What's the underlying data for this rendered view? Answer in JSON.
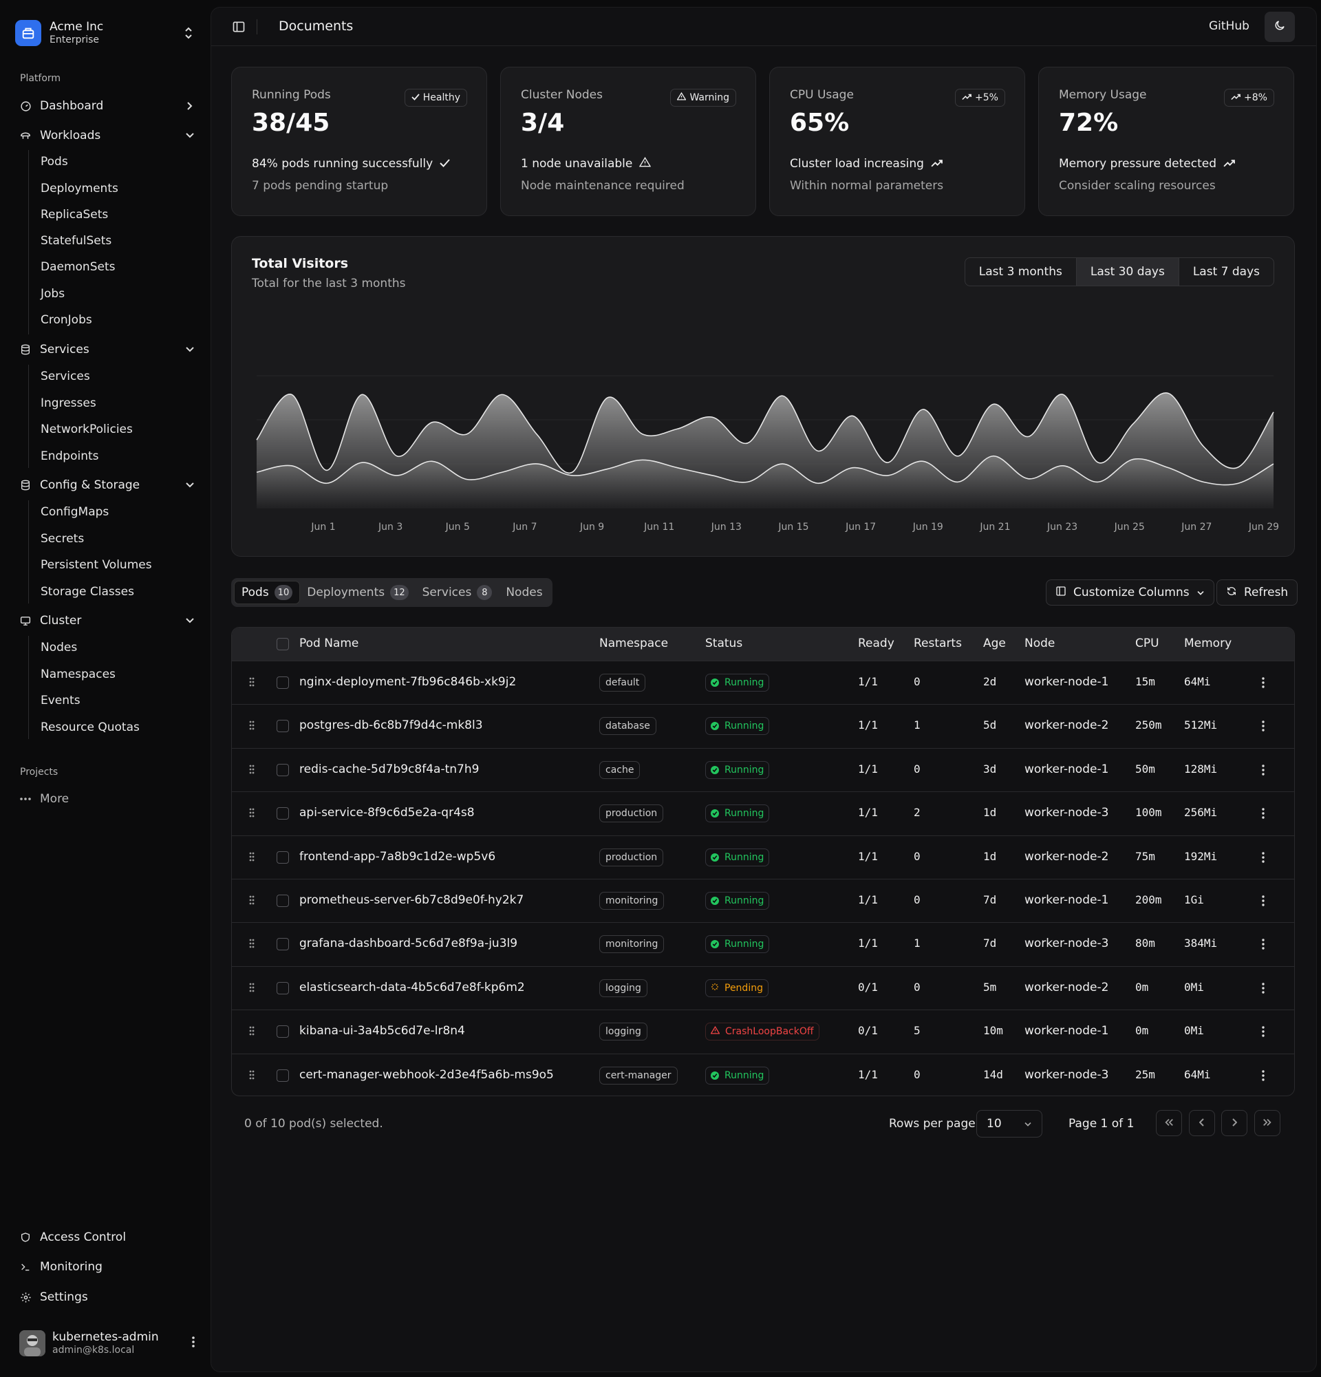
{
  "team": {
    "name": "Acme Inc",
    "plan": "Enterprise"
  },
  "sidebar": {
    "platform_label": "Platform",
    "dashboard": "Dashboard",
    "workloads": {
      "label": "Workloads",
      "items": [
        "Pods",
        "Deployments",
        "ReplicaSets",
        "StatefulSets",
        "DaemonSets",
        "Jobs",
        "CronJobs"
      ]
    },
    "services": {
      "label": "Services",
      "items": [
        "Services",
        "Ingresses",
        "NetworkPolicies",
        "Endpoints"
      ]
    },
    "config": {
      "label": "Config & Storage",
      "items": [
        "ConfigMaps",
        "Secrets",
        "Persistent Volumes",
        "Storage Classes"
      ]
    },
    "cluster": {
      "label": "Cluster",
      "items": [
        "Nodes",
        "Namespaces",
        "Events",
        "Resource Quotas"
      ]
    },
    "projects_label": "Projects",
    "more": "More",
    "bottom": {
      "access": "Access Control",
      "monitoring": "Monitoring",
      "settings": "Settings"
    }
  },
  "user": {
    "name": "kubernetes-admin",
    "email": "admin@k8s.local"
  },
  "header": {
    "title": "Documents",
    "github": "GitHub"
  },
  "cards": [
    {
      "label": "Running Pods",
      "badge": "Healthy",
      "value": "38/45",
      "line1": "84% pods running successfully",
      "line2": "7 pods pending startup"
    },
    {
      "label": "Cluster Nodes",
      "badge": "Warning",
      "value": "3/4",
      "line1": "1 node unavailable",
      "line2": "Node maintenance required"
    },
    {
      "label": "CPU Usage",
      "badge": "+5%",
      "value": "65%",
      "line1": "Cluster load increasing",
      "line2": "Within normal parameters"
    },
    {
      "label": "Memory Usage",
      "badge": "+8%",
      "value": "72%",
      "line1": "Memory pressure detected",
      "line2": "Consider scaling resources"
    }
  ],
  "chart": {
    "title": "Total Visitors",
    "subtitle": "Total for the last 3 months",
    "ranges": [
      "Last 3 months",
      "Last 30 days",
      "Last 7 days"
    ],
    "active_range": "Last 30 days"
  },
  "chart_data": {
    "type": "area",
    "x_ticks": [
      "Jun 1",
      "Jun 3",
      "Jun 5",
      "Jun 7",
      "Jun 9",
      "Jun 11",
      "Jun 13",
      "Jun 15",
      "Jun 17",
      "Jun 19",
      "Jun 21",
      "Jun 23",
      "Jun 25",
      "Jun 27",
      "Jun 29"
    ],
    "grid": true,
    "stacked": true,
    "series": [
      {
        "values": [
          55,
          65,
          38,
          70,
          50,
          72,
          44,
          55,
          68,
          50,
          60,
          74,
          62,
          50,
          40,
          68,
          38,
          62,
          50,
          72,
          40,
          80,
          45,
          65,
          40,
          75,
          62,
          40,
          38,
          68
        ]
      },
      {
        "values": [
          50,
          110,
          20,
          105,
          30,
          60,
          70,
          120,
          45,
          5,
          110,
          40,
          60,
          90,
          60,
          105,
          50,
          80,
          20,
          80,
          40,
          80,
          65,
          110,
          30,
          55,
          115,
          55,
          25,
          80
        ]
      }
    ]
  },
  "tabs": [
    {
      "label": "Pods",
      "count": "10"
    },
    {
      "label": "Deployments",
      "count": "12"
    },
    {
      "label": "Services",
      "count": "8"
    },
    {
      "label": "Nodes",
      "count": ""
    }
  ],
  "actions": {
    "customize": "Customize Columns",
    "refresh": "Refresh"
  },
  "table": {
    "headers": {
      "name": "Pod Name",
      "namespace": "Namespace",
      "status": "Status",
      "ready": "Ready",
      "restarts": "Restarts",
      "age": "Age",
      "node": "Node",
      "cpu": "CPU",
      "memory": "Memory"
    },
    "rows": [
      {
        "name": "nginx-deployment-7fb96c846b-xk9j2",
        "namespace": "default",
        "status": "Running",
        "ready": "1/1",
        "restarts": "0",
        "age": "2d",
        "node": "worker-node-1",
        "cpu": "15m",
        "memory": "64Mi"
      },
      {
        "name": "postgres-db-6c8b7f9d4c-mk8l3",
        "namespace": "database",
        "status": "Running",
        "ready": "1/1",
        "restarts": "1",
        "age": "5d",
        "node": "worker-node-2",
        "cpu": "250m",
        "memory": "512Mi"
      },
      {
        "name": "redis-cache-5d7b9c8f4a-tn7h9",
        "namespace": "cache",
        "status": "Running",
        "ready": "1/1",
        "restarts": "0",
        "age": "3d",
        "node": "worker-node-1",
        "cpu": "50m",
        "memory": "128Mi"
      },
      {
        "name": "api-service-8f9c6d5e2a-qr4s8",
        "namespace": "production",
        "status": "Running",
        "ready": "1/1",
        "restarts": "2",
        "age": "1d",
        "node": "worker-node-3",
        "cpu": "100m",
        "memory": "256Mi"
      },
      {
        "name": "frontend-app-7a8b9c1d2e-wp5v6",
        "namespace": "production",
        "status": "Running",
        "ready": "1/1",
        "restarts": "0",
        "age": "1d",
        "node": "worker-node-2",
        "cpu": "75m",
        "memory": "192Mi"
      },
      {
        "name": "prometheus-server-6b7c8d9e0f-hy2k7",
        "namespace": "monitoring",
        "status": "Running",
        "ready": "1/1",
        "restarts": "0",
        "age": "7d",
        "node": "worker-node-1",
        "cpu": "200m",
        "memory": "1Gi"
      },
      {
        "name": "grafana-dashboard-5c6d7e8f9a-ju3l9",
        "namespace": "monitoring",
        "status": "Running",
        "ready": "1/1",
        "restarts": "1",
        "age": "7d",
        "node": "worker-node-3",
        "cpu": "80m",
        "memory": "384Mi"
      },
      {
        "name": "elasticsearch-data-4b5c6d7e8f-kp6m2",
        "namespace": "logging",
        "status": "Pending",
        "ready": "0/1",
        "restarts": "0",
        "age": "5m",
        "node": "worker-node-2",
        "cpu": "0m",
        "memory": "0Mi"
      },
      {
        "name": "kibana-ui-3a4b5c6d7e-lr8n4",
        "namespace": "logging",
        "status": "CrashLoopBackOff",
        "ready": "0/1",
        "restarts": "5",
        "age": "10m",
        "node": "worker-node-1",
        "cpu": "0m",
        "memory": "0Mi"
      },
      {
        "name": "cert-manager-webhook-2d3e4f5a6b-ms9o5",
        "namespace": "cert-manager",
        "status": "Running",
        "ready": "1/1",
        "restarts": "0",
        "age": "14d",
        "node": "worker-node-3",
        "cpu": "25m",
        "memory": "64Mi"
      }
    ]
  },
  "footer": {
    "selected": "0 of 10 pod(s) selected.",
    "rows_per_page_label": "Rows per page",
    "rows_per_page": "10",
    "page": "Page 1 of 1"
  },
  "colors": {
    "accent": "#2f6fed",
    "running": "#22c55e",
    "pending": "#f59e0b",
    "crash": "#ef4444"
  }
}
